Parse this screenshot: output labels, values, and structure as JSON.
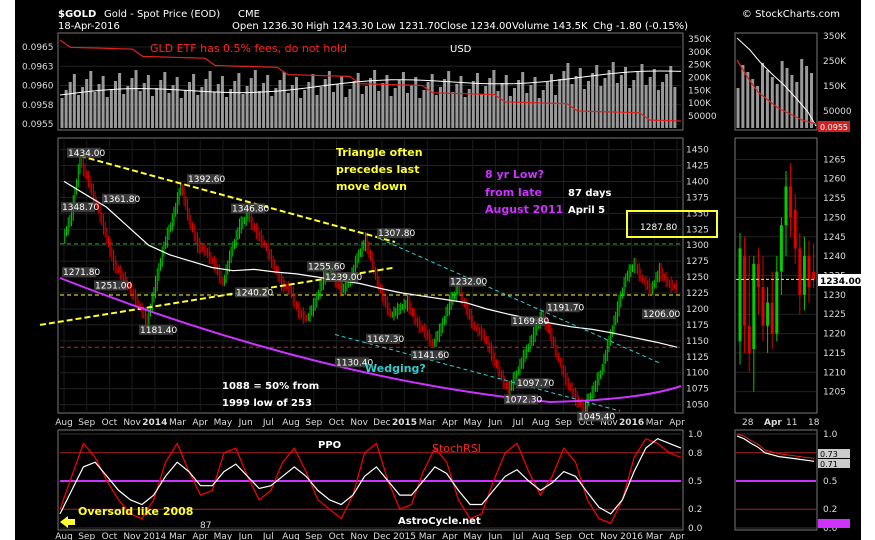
{
  "header": {
    "symbol": "$GOLD",
    "name": "Gold - Spot Price (EOD)",
    "exchange": "CME",
    "date": "18-Apr-2016",
    "watermark": "© StockCharts.com",
    "open": "Open 1236.30",
    "high": "High 1243.30",
    "low": "Low 1231.70",
    "close": "Close 1234.00",
    "volume": "Volume 143.5K",
    "chg": "Chg -1.80 (-0.15%)"
  },
  "colors": {
    "background": "#000000",
    "up": "#00cc00",
    "down": "#dd0000",
    "volume": "#999999",
    "ma": "#ffffff",
    "yellow_annot": "#ffff33",
    "magenta_annot": "#cc33ff",
    "cyan_annot": "#33cccc",
    "red_text": "#ff2222",
    "ppo_signal": "#ff0000"
  },
  "annotations": {
    "gld": "GLD ETF has 0.5% fees, do not hold",
    "usd": "USD",
    "triangle": [
      "Triangle often",
      "precedes last",
      "move down"
    ],
    "low8": [
      "8 yr Low?",
      "from late",
      "August 2011"
    ],
    "days": [
      "87 days",
      "April 5"
    ],
    "wedging": "Wedging?",
    "fifty": [
      "1088 = 50% from",
      "1999  low of 253"
    ],
    "ppo": "PPO",
    "stoch": "StochRSI",
    "oversold": "Oversold like 2008",
    "site": "AstroCycle.net",
    "box_label": "1287.80",
    "price_tag": "1234.00",
    "usd_tag": "0.0955",
    "stoch_tags": [
      "0.73",
      "0.71"
    ],
    "ppo_small": "87"
  },
  "chart_data": [
    {
      "type": "line",
      "panel": "USD (gold price in dollars) with volume",
      "y_ticks": [
        "0.0965",
        "0.0963",
        "0.0960",
        "0.0958",
        "0.0955"
      ],
      "volume_ticks": [
        "350K",
        "300K",
        "250K",
        "200K",
        "150K",
        "100K",
        "50000"
      ],
      "series": []
    },
    {
      "type": "line",
      "panel": "main price",
      "x_ticks": [
        "Aug",
        "Sep",
        "Oct",
        "Nov",
        "2014",
        "Mar",
        "Apr",
        "May",
        "Jun",
        "Jul",
        "Aug",
        "Sep",
        "Oct",
        "Nov",
        "Dec",
        "2015",
        "Mar",
        "Apr",
        "May",
        "Jun",
        "Jul",
        "Aug",
        "Sep",
        "Oct",
        "Nov",
        "2016",
        "Mar",
        "Apr"
      ],
      "y_ticks": [
        1450,
        1425,
        1400,
        1375,
        1350,
        1325,
        1300,
        1275,
        1250,
        1225,
        1200,
        1175,
        1150,
        1125,
        1100,
        1075,
        1050
      ],
      "ylim": [
        1040,
        1465
      ],
      "pivots": [
        {
          "label": "1348.70",
          "value": 1348.7
        },
        {
          "label": "1434.00",
          "value": 1434.0
        },
        {
          "label": "1361.80",
          "value": 1361.8
        },
        {
          "label": "1271.80",
          "value": 1271.8
        },
        {
          "label": "1251.00",
          "value": 1251.0
        },
        {
          "label": "1181.40",
          "value": 1181.4
        },
        {
          "label": "1392.60",
          "value": 1392.6
        },
        {
          "label": "1240.20",
          "value": 1240.2
        },
        {
          "label": "1346.80",
          "value": 1346.8
        },
        {
          "label": "1255.60",
          "value": 1255.6
        },
        {
          "label": "1239.00",
          "value": 1239.0
        },
        {
          "label": "1307.80",
          "value": 1307.8
        },
        {
          "label": "1130.40",
          "value": 1130.4
        },
        {
          "label": "1167.30",
          "value": 1167.3
        },
        {
          "label": "1141.60",
          "value": 1141.6
        },
        {
          "label": "1232.00",
          "value": 1232.0
        },
        {
          "label": "1169.80",
          "value": 1169.8
        },
        {
          "label": "1191.70",
          "value": 1191.7
        },
        {
          "label": "1097.70",
          "value": 1097.7
        },
        {
          "label": "1072.30",
          "value": 1072.3
        },
        {
          "label": "1045.40",
          "value": 1045.4
        },
        {
          "label": "1206.00",
          "value": 1206.0
        }
      ],
      "series": [
        {
          "values": [
            1310,
            1350,
            1434,
            1400,
            1362,
            1320,
            1272,
            1251,
            1230,
            1205,
            1181,
            1240,
            1300,
            1340,
            1392,
            1340,
            1300,
            1290,
            1270,
            1240,
            1290,
            1330,
            1347,
            1320,
            1300,
            1270,
            1240,
            1230,
            1195,
            1185,
            1210,
            1250,
            1256,
            1230,
            1239,
            1280,
            1308,
            1260,
            1220,
            1190,
            1200,
            1210,
            1180,
            1165,
            1145,
            1170,
            1210,
            1232,
            1200,
            1170,
            1160,
            1130,
            1098,
            1072,
            1100,
            1130,
            1160,
            1192,
            1160,
            1120,
            1085,
            1060,
            1045,
            1070,
            1100,
            1150,
            1200,
            1250,
            1270,
            1245,
            1230,
            1260,
            1240,
            1234
          ]
        },
        {
          "values": [
            1400,
            1380,
            1360,
            1330,
            1300,
            1285,
            1275,
            1265,
            1260,
            1262,
            1258,
            1255,
            1250,
            1245,
            1240,
            1232,
            1225,
            1220,
            1215,
            1210,
            1200,
            1192,
            1185,
            1178,
            1172,
            1168,
            1162,
            1155,
            1148,
            1140
          ]
        }
      ]
    },
    {
      "type": "bar",
      "panel": "recent daily price (candles)",
      "x_ticks": [
        "28",
        "Apr",
        "11",
        "18"
      ],
      "y_ticks": [
        1265,
        1260,
        1255,
        1250,
        1245,
        1240,
        1235,
        1230,
        1225,
        1220,
        1215,
        1210,
        1205
      ],
      "ylim": [
        1200,
        1270
      ],
      "candles": [
        {
          "o": 1218,
          "h": 1246,
          "l": 1212,
          "c": 1242
        },
        {
          "o": 1240,
          "h": 1245,
          "l": 1215,
          "c": 1222
        },
        {
          "o": 1222,
          "h": 1240,
          "l": 1210,
          "c": 1215
        },
        {
          "o": 1216,
          "h": 1240,
          "l": 1205,
          "c": 1238
        },
        {
          "o": 1238,
          "h": 1242,
          "l": 1225,
          "c": 1232
        },
        {
          "o": 1232,
          "h": 1240,
          "l": 1218,
          "c": 1222
        },
        {
          "o": 1222,
          "h": 1232,
          "l": 1215,
          "c": 1228
        },
        {
          "o": 1228,
          "h": 1236,
          "l": 1216,
          "c": 1220
        },
        {
          "o": 1220,
          "h": 1240,
          "l": 1218,
          "c": 1236
        },
        {
          "o": 1236,
          "h": 1250,
          "l": 1230,
          "c": 1248
        },
        {
          "o": 1248,
          "h": 1262,
          "l": 1240,
          "c": 1258
        },
        {
          "o": 1258,
          "h": 1264,
          "l": 1245,
          "c": 1250
        },
        {
          "o": 1252,
          "h": 1256,
          "l": 1238,
          "c": 1242
        },
        {
          "o": 1242,
          "h": 1246,
          "l": 1225,
          "c": 1230
        },
        {
          "o": 1230,
          "h": 1245,
          "l": 1226,
          "c": 1240
        },
        {
          "o": 1240,
          "h": 1244,
          "l": 1228,
          "c": 1232
        },
        {
          "o": 1236,
          "h": 1243.3,
          "l": 1231.7,
          "c": 1234
        }
      ]
    },
    {
      "type": "line",
      "panel": "PPO / StochRSI",
      "y_ticks": [
        "1.0",
        "0.8",
        "0.5",
        "0.2",
        "0.0"
      ],
      "x_ticks": [
        "Aug",
        "Sep",
        "Oct",
        "Nov",
        "2014",
        "Mar",
        "Apr",
        "May",
        "Jun",
        "Jul",
        "Aug",
        "Sep",
        "Oct",
        "Nov",
        "Dec",
        "2015",
        "Mar",
        "Apr",
        "May",
        "Jun",
        "Jul",
        "Aug",
        "Sep",
        "Oct",
        "Nov",
        "2016",
        "Mar",
        "Apr"
      ],
      "ylim": [
        0,
        1
      ],
      "series": [
        {
          "values": [
            0.2,
            0.55,
            0.9,
            0.75,
            0.5,
            0.3,
            0.15,
            0.1,
            0.3,
            0.7,
            0.9,
            0.6,
            0.35,
            0.4,
            0.8,
            0.85,
            0.55,
            0.3,
            0.4,
            0.7,
            0.85,
            0.6,
            0.3,
            0.2,
            0.1,
            0.35,
            0.8,
            0.9,
            0.5,
            0.2,
            0.25,
            0.6,
            0.85,
            0.7,
            0.3,
            0.1,
            0.15,
            0.5,
            0.8,
            0.9,
            0.6,
            0.35,
            0.55,
            0.85,
            0.7,
            0.3,
            0.1,
            0.05,
            0.3,
            0.75,
            0.95,
            0.9,
            0.8,
            0.75
          ]
        },
        {
          "values": [
            0.15,
            0.4,
            0.65,
            0.7,
            0.55,
            0.4,
            0.3,
            0.25,
            0.35,
            0.55,
            0.7,
            0.6,
            0.45,
            0.45,
            0.6,
            0.68,
            0.55,
            0.42,
            0.45,
            0.55,
            0.65,
            0.55,
            0.4,
            0.3,
            0.25,
            0.35,
            0.55,
            0.65,
            0.5,
            0.35,
            0.35,
            0.5,
            0.65,
            0.58,
            0.4,
            0.25,
            0.25,
            0.4,
            0.55,
            0.62,
            0.5,
            0.4,
            0.48,
            0.6,
            0.55,
            0.38,
            0.22,
            0.15,
            0.3,
            0.6,
            0.85,
            0.95,
            0.9,
            0.85
          ]
        }
      ]
    },
    {
      "type": "line",
      "panel": "StochRSI recent",
      "y_ticks": [
        "1.0",
        "0.8",
        "0.5",
        "0.2",
        "0.0"
      ],
      "ylim": [
        0,
        1
      ],
      "series": [
        {
          "values": [
            0.98,
            0.95,
            0.9,
            0.86,
            0.8,
            0.78,
            0.76,
            0.75,
            0.74,
            0.73,
            0.72,
            0.71
          ]
        }
      ]
    }
  ]
}
